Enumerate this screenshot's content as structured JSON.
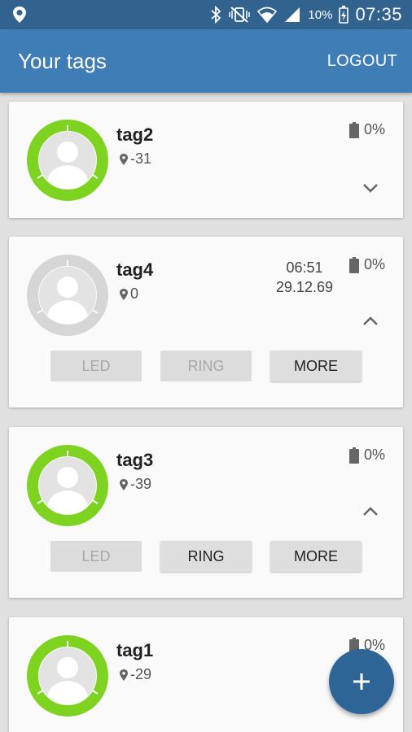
{
  "statusbar": {
    "battery_percent": "10%",
    "time": "07:35"
  },
  "appbar": {
    "title": "Your tags",
    "logout_label": "LOGOUT"
  },
  "colors": {
    "accent": "#3f7db7",
    "ring_active": "#7ed321",
    "ring_inactive": "#d6d6d6"
  },
  "tags": [
    {
      "name": "tag2",
      "rssi": "-31",
      "battery": "0%",
      "expanded": false,
      "ring": "green"
    },
    {
      "name": "tag4",
      "rssi": "0",
      "battery": "0%",
      "time": "06:51",
      "date": "29.12.69",
      "expanded": true,
      "ring": "gray",
      "buttons": {
        "led": "LED",
        "ring": "RING",
        "more": "MORE"
      }
    },
    {
      "name": "tag3",
      "rssi": "-39",
      "battery": "0%",
      "expanded": true,
      "ring": "green",
      "buttons": {
        "led": "LED",
        "ring": "RING",
        "more": "MORE"
      }
    },
    {
      "name": "tag1",
      "rssi": "-29",
      "battery": "0%",
      "expanded": false,
      "ring": "green"
    }
  ],
  "fab": {
    "icon": "plus-icon"
  }
}
